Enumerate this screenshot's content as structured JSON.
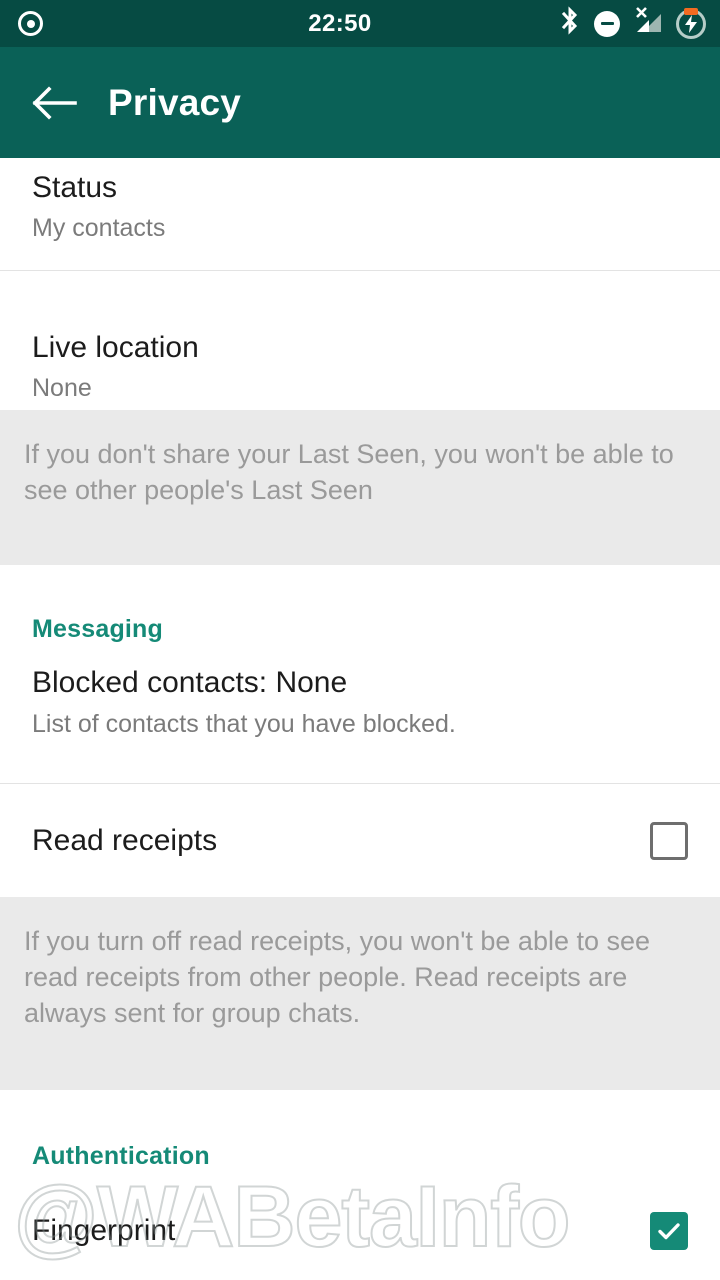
{
  "status_bar": {
    "time": "22:50",
    "icons": {
      "recording": "record-circle-icon",
      "bluetooth": "bluetooth-icon",
      "do_not_disturb": "do-not-disturb-icon",
      "signal": "signal-no-service-icon",
      "battery": "battery-charging-icon"
    }
  },
  "app_bar": {
    "back": "back-arrow-icon",
    "title": "Privacy"
  },
  "settings": {
    "status_row": {
      "title": "Status",
      "value": "My contacts"
    },
    "live_location_row": {
      "title": "Live location",
      "value": "None"
    },
    "last_seen_info": "If you don't share your Last Seen, you won't be able to see other people's Last Seen",
    "messaging_header": "Messaging",
    "blocked_contacts_row": {
      "title": "Blocked contacts: None",
      "value": "List of contacts that you have blocked."
    },
    "read_receipts_row": {
      "title": "Read receipts",
      "checked": false
    },
    "read_receipts_info": "If you turn off read receipts, you won't be able to see read receipts from other people. Read receipts are always sent for group chats.",
    "authentication_header": "Authentication",
    "fingerprint_row": {
      "title": "Fingerprint",
      "checked": true
    }
  },
  "watermark": {
    "text": "@WABetaInfo"
  },
  "colors": {
    "status_bar": "#064b43",
    "app_bar": "#0a6157",
    "accent": "#158a77",
    "info_background": "#eaeaea",
    "battery_charge": "#f26b21"
  }
}
